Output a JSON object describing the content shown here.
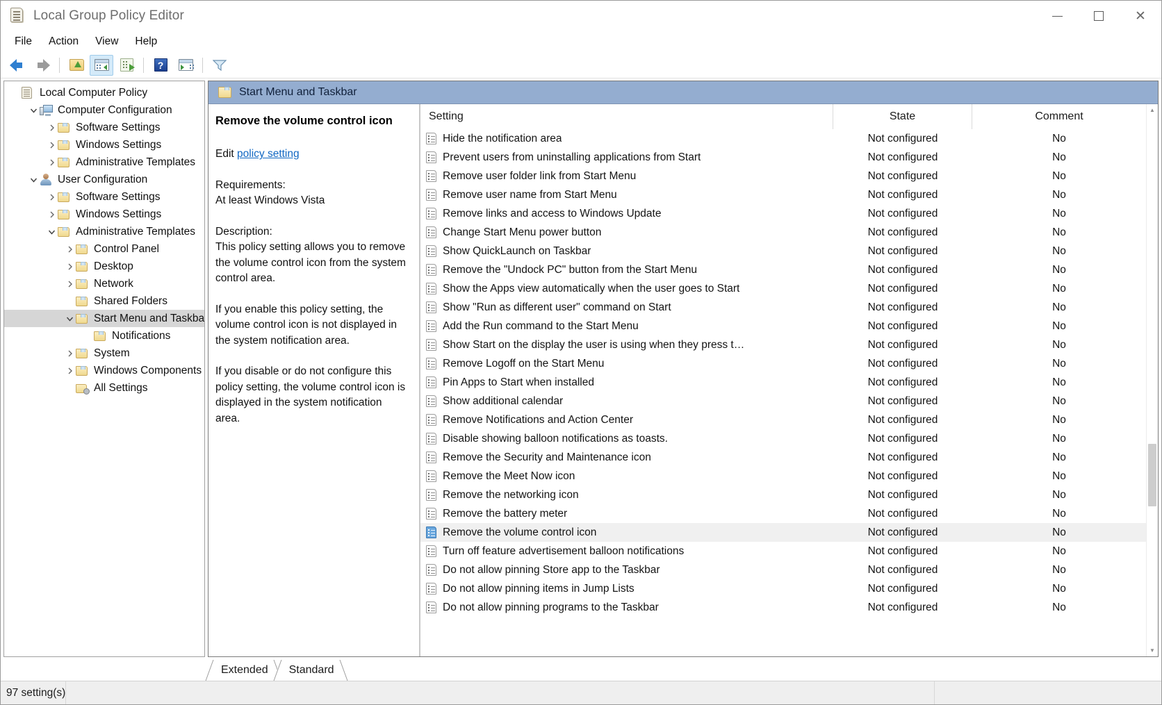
{
  "window": {
    "title": "Local Group Policy Editor",
    "icon": "policy-scroll-icon",
    "minimize_label": "Minimize",
    "maximize_label": "Maximize",
    "close_label": "Close"
  },
  "menubar": {
    "items": [
      {
        "label": "File"
      },
      {
        "label": "Action"
      },
      {
        "label": "View"
      },
      {
        "label": "Help"
      }
    ]
  },
  "toolbar": {
    "buttons": [
      {
        "name": "back-button",
        "icon": "left-arrow-icon",
        "label": "Back"
      },
      {
        "name": "forward-button",
        "icon": "right-arrow-icon",
        "label": "Forward"
      },
      {
        "name": "up-one-level-button",
        "icon": "folder-up-icon",
        "label": "Up one level"
      },
      {
        "name": "show-hide-console-tree-button",
        "icon": "console-tree-icon",
        "label": "Show/Hide Console Tree"
      },
      {
        "name": "export-list-button",
        "icon": "export-list-icon",
        "label": "Export List"
      },
      {
        "name": "help-button",
        "icon": "help-icon",
        "label": "Help"
      },
      {
        "name": "show-hide-action-pane-button",
        "icon": "action-pane-icon",
        "label": "Show/Hide Action Pane"
      },
      {
        "name": "filter-button",
        "icon": "filter-icon",
        "label": "Filter"
      }
    ]
  },
  "tree": {
    "nodes": [
      {
        "label": "Local Computer Policy",
        "indent": 0,
        "twist": "none",
        "icon": "policy-scroll-icon",
        "selected": false
      },
      {
        "label": "Computer Configuration",
        "indent": 1,
        "twist": "expanded",
        "icon": "computer-icon",
        "selected": false
      },
      {
        "label": "Software Settings",
        "indent": 2,
        "twist": "collapsed",
        "icon": "folder-icon",
        "selected": false
      },
      {
        "label": "Windows Settings",
        "indent": 2,
        "twist": "collapsed",
        "icon": "folder-icon",
        "selected": false
      },
      {
        "label": "Administrative Templates",
        "indent": 2,
        "twist": "collapsed",
        "icon": "folder-icon",
        "selected": false
      },
      {
        "label": "User Configuration",
        "indent": 1,
        "twist": "expanded",
        "icon": "user-icon",
        "selected": false
      },
      {
        "label": "Software Settings",
        "indent": 2,
        "twist": "collapsed",
        "icon": "folder-icon",
        "selected": false
      },
      {
        "label": "Windows Settings",
        "indent": 2,
        "twist": "collapsed",
        "icon": "folder-icon",
        "selected": false
      },
      {
        "label": "Administrative Templates",
        "indent": 2,
        "twist": "expanded",
        "icon": "folder-icon",
        "selected": false
      },
      {
        "label": "Control Panel",
        "indent": 3,
        "twist": "collapsed",
        "icon": "folder-icon",
        "selected": false
      },
      {
        "label": "Desktop",
        "indent": 3,
        "twist": "collapsed",
        "icon": "folder-icon",
        "selected": false
      },
      {
        "label": "Network",
        "indent": 3,
        "twist": "collapsed",
        "icon": "folder-icon",
        "selected": false
      },
      {
        "label": "Shared Folders",
        "indent": 3,
        "twist": "none",
        "icon": "folder-icon",
        "selected": false
      },
      {
        "label": "Start Menu and Taskbar",
        "indent": 3,
        "twist": "expanded",
        "icon": "folder-icon",
        "selected": true
      },
      {
        "label": "Notifications",
        "indent": 4,
        "twist": "none",
        "icon": "folder-icon",
        "selected": false
      },
      {
        "label": "System",
        "indent": 3,
        "twist": "collapsed",
        "icon": "folder-icon",
        "selected": false
      },
      {
        "label": "Windows Components",
        "indent": 3,
        "twist": "collapsed",
        "icon": "folder-icon",
        "selected": false
      },
      {
        "label": "All Settings",
        "indent": 3,
        "twist": "none",
        "icon": "all-settings-icon",
        "selected": false
      }
    ]
  },
  "pane": {
    "header_title": "Start Menu and Taskbar",
    "header_icon": "folder-icon",
    "header_color": "#94add0"
  },
  "description": {
    "title": "Remove the volume control icon",
    "edit_prefix": "Edit ",
    "edit_link": "policy setting",
    "requirements_label": "Requirements:",
    "requirements_value": "At least Windows Vista",
    "description_label": "Description:",
    "paragraphs": [
      "This policy setting allows you to remove the volume control icon from the system control area.",
      "If you enable this policy setting, the volume control icon is not displayed in the system notification area.",
      "If you disable or do not configure this policy setting, the volume control icon is displayed in the system notification area."
    ]
  },
  "list": {
    "columns": [
      {
        "key": "setting",
        "label": "Setting"
      },
      {
        "key": "state",
        "label": "State"
      },
      {
        "key": "comment",
        "label": "Comment"
      }
    ],
    "rows": [
      {
        "setting": "Hide the notification area",
        "state": "Not configured",
        "comment": "No",
        "selected": false
      },
      {
        "setting": "Prevent users from uninstalling applications from Start",
        "state": "Not configured",
        "comment": "No",
        "selected": false
      },
      {
        "setting": "Remove user folder link from Start Menu",
        "state": "Not configured",
        "comment": "No",
        "selected": false
      },
      {
        "setting": "Remove user name from Start Menu",
        "state": "Not configured",
        "comment": "No",
        "selected": false
      },
      {
        "setting": "Remove links and access to Windows Update",
        "state": "Not configured",
        "comment": "No",
        "selected": false
      },
      {
        "setting": "Change Start Menu power button",
        "state": "Not configured",
        "comment": "No",
        "selected": false
      },
      {
        "setting": "Show QuickLaunch on Taskbar",
        "state": "Not configured",
        "comment": "No",
        "selected": false
      },
      {
        "setting": "Remove the \"Undock PC\" button from the Start Menu",
        "state": "Not configured",
        "comment": "No",
        "selected": false
      },
      {
        "setting": "Show the Apps view automatically when the user goes to Start",
        "state": "Not configured",
        "comment": "No",
        "selected": false
      },
      {
        "setting": "Show \"Run as different user\" command on Start",
        "state": "Not configured",
        "comment": "No",
        "selected": false
      },
      {
        "setting": "Add the Run command to the Start Menu",
        "state": "Not configured",
        "comment": "No",
        "selected": false
      },
      {
        "setting": "Show Start on the display the user is using when they press t…",
        "state": "Not configured",
        "comment": "No",
        "selected": false
      },
      {
        "setting": "Remove Logoff on the Start Menu",
        "state": "Not configured",
        "comment": "No",
        "selected": false
      },
      {
        "setting": "Pin Apps to Start when installed",
        "state": "Not configured",
        "comment": "No",
        "selected": false
      },
      {
        "setting": "Show additional calendar",
        "state": "Not configured",
        "comment": "No",
        "selected": false
      },
      {
        "setting": "Remove Notifications and Action Center",
        "state": "Not configured",
        "comment": "No",
        "selected": false
      },
      {
        "setting": "Disable showing balloon notifications as toasts.",
        "state": "Not configured",
        "comment": "No",
        "selected": false
      },
      {
        "setting": "Remove the Security and Maintenance icon",
        "state": "Not configured",
        "comment": "No",
        "selected": false
      },
      {
        "setting": "Remove the Meet Now icon",
        "state": "Not configured",
        "comment": "No",
        "selected": false
      },
      {
        "setting": "Remove the networking icon",
        "state": "Not configured",
        "comment": "No",
        "selected": false
      },
      {
        "setting": "Remove the battery meter",
        "state": "Not configured",
        "comment": "No",
        "selected": false
      },
      {
        "setting": "Remove the volume control icon",
        "state": "Not configured",
        "comment": "No",
        "selected": true
      },
      {
        "setting": "Turn off feature advertisement balloon notifications",
        "state": "Not configured",
        "comment": "No",
        "selected": false
      },
      {
        "setting": "Do not allow pinning Store app to the Taskbar",
        "state": "Not configured",
        "comment": "No",
        "selected": false
      },
      {
        "setting": "Do not allow pinning items in Jump Lists",
        "state": "Not configured",
        "comment": "No",
        "selected": false
      },
      {
        "setting": "Do not allow pinning programs to the Taskbar",
        "state": "Not configured",
        "comment": "No",
        "selected": false
      }
    ]
  },
  "tabs": [
    {
      "label": "Extended",
      "active": false
    },
    {
      "label": "Standard",
      "active": true
    }
  ],
  "statusbar": {
    "text": "97 setting(s)"
  }
}
